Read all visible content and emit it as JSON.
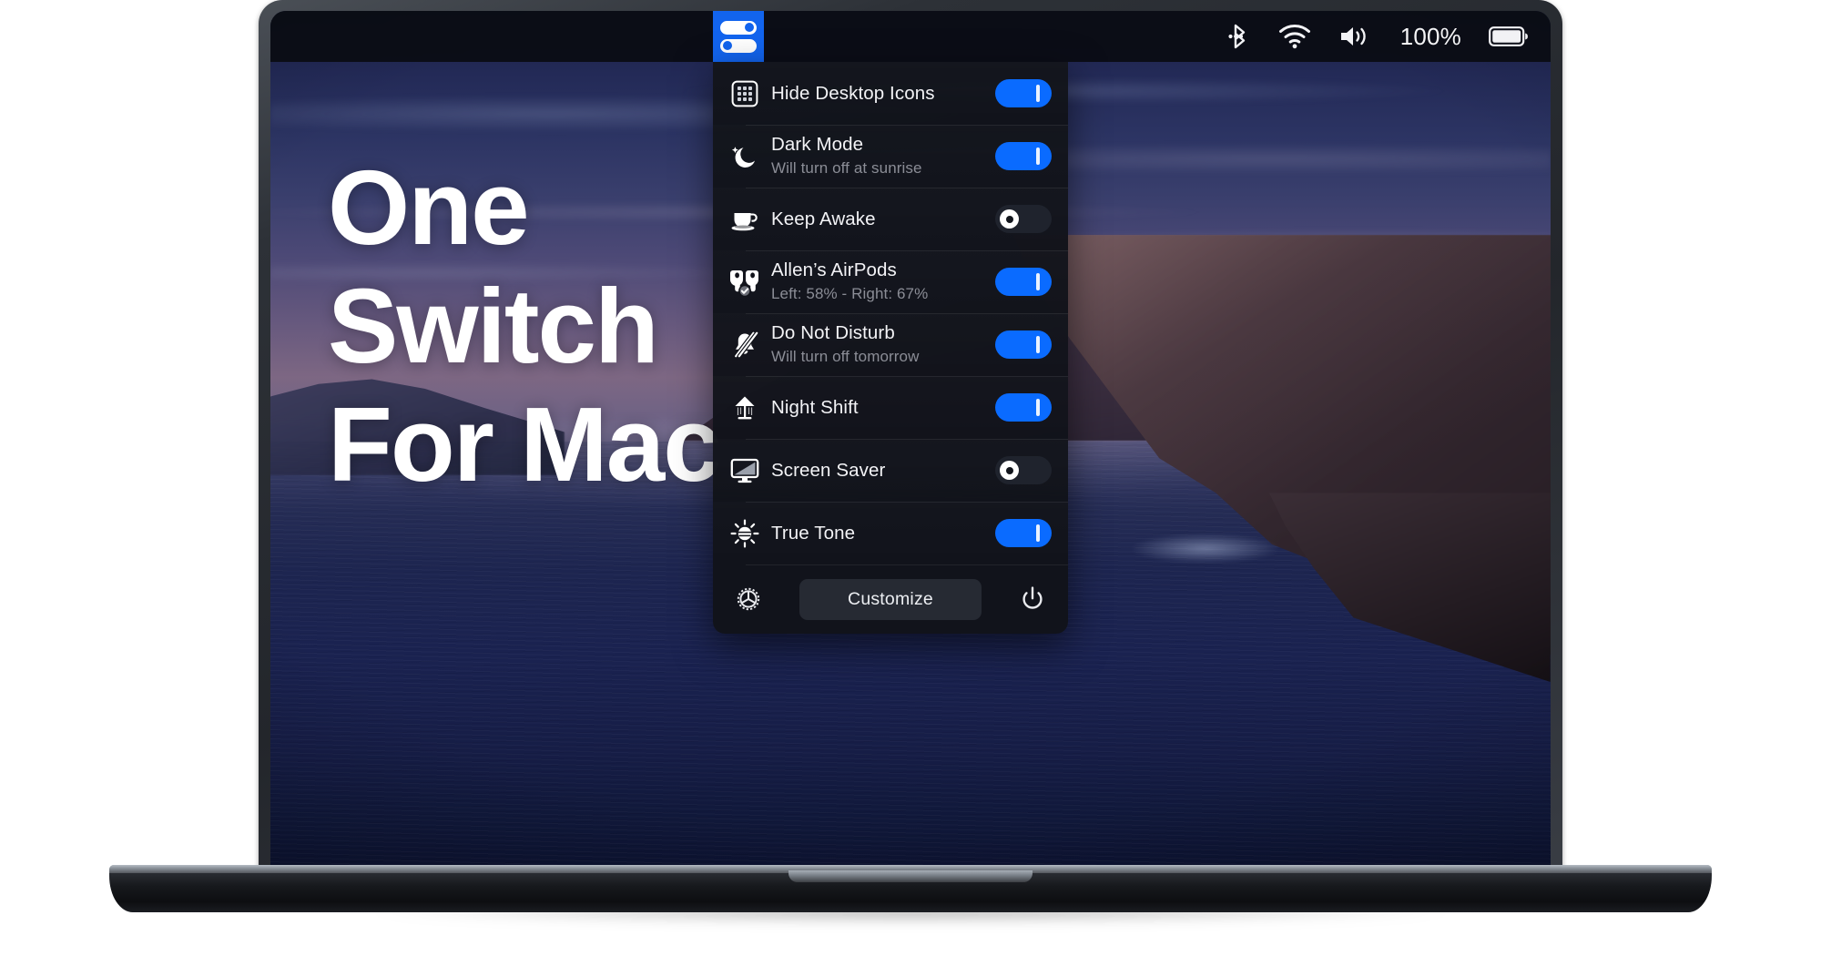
{
  "headline": {
    "line1": "One",
    "line2": "Switch",
    "line3": "For Mac"
  },
  "menubar": {
    "app_icon": "oneswitch-toggles-icon",
    "status_icons": [
      "bluetooth-icon",
      "wifi-icon",
      "volume-icon"
    ],
    "battery_percent": "100%",
    "battery_icon": "battery-full-icon"
  },
  "panel": {
    "rows": [
      {
        "icon": "desktop-grid-icon",
        "title": "Hide Desktop Icons",
        "subtitle": "",
        "state": "on"
      },
      {
        "icon": "moon-stars-icon",
        "title": "Dark Mode",
        "subtitle": "Will turn off at sunrise",
        "state": "on"
      },
      {
        "icon": "coffee-cup-icon",
        "title": "Keep Awake",
        "subtitle": "",
        "state": "off"
      },
      {
        "icon": "airpods-icon",
        "title": "Allen’s AirPods",
        "subtitle": "Left: 58% - Right: 67%",
        "state": "on"
      },
      {
        "icon": "bell-slash-icon",
        "title": "Do Not Disturb",
        "subtitle": "Will turn off tomorrow",
        "state": "on"
      },
      {
        "icon": "desk-lamp-icon",
        "title": "Night Shift",
        "subtitle": "",
        "state": "on"
      },
      {
        "icon": "display-icon",
        "title": "Screen Saver",
        "subtitle": "",
        "state": "off"
      },
      {
        "icon": "sun-tone-icon",
        "title": "True Tone",
        "subtitle": "",
        "state": "on"
      }
    ],
    "footer": {
      "settings_icon": "gear-icon",
      "customize_label": "Customize",
      "power_icon": "power-icon"
    }
  },
  "colors": {
    "accent_blue": "#0a6bff",
    "menubar_highlight": "#1264ee",
    "panel_bg": "#11131a",
    "toggle_off_bg": "#1f232d",
    "text_primary": "#f3f3f6",
    "text_secondary": "#8b8d96"
  }
}
